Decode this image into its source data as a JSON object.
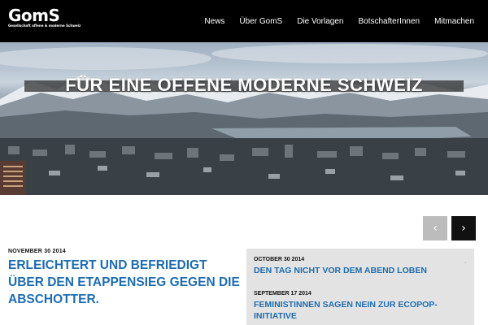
{
  "header": {
    "logo_main": "GomS",
    "logo_sub": "Gesellschaft offene & moderne Schweiz",
    "nav": [
      "News",
      "Über GomS",
      "Die Vorlagen",
      "BotschafterInnen",
      "Mitmachen"
    ]
  },
  "hero": {
    "title": "FÜR EINE OFFENE MODERNE SCHWEIZ"
  },
  "carousel": {
    "prev_icon": "chevron-left-icon",
    "next_icon": "chevron-right-icon",
    "prev_glyph": "‹",
    "next_glyph": "›"
  },
  "main_post": {
    "date": "NOVEMBER 30 2014",
    "title": "Erleichtert und befriedigt über den Etappensieg gegen die Abschotter."
  },
  "side_posts": [
    {
      "date": "OCTOBER 30 2014",
      "title": "Den Tag nicht vor dem Abend loben"
    },
    {
      "date": "SEPTEMBER 17 2014",
      "title": "Feministinnen sagen Nein zur Ecopop-Initiative"
    }
  ],
  "colors": {
    "header_bg": "#000000",
    "link_blue": "#1e6cb0",
    "side_bg": "#e3e3e3"
  }
}
